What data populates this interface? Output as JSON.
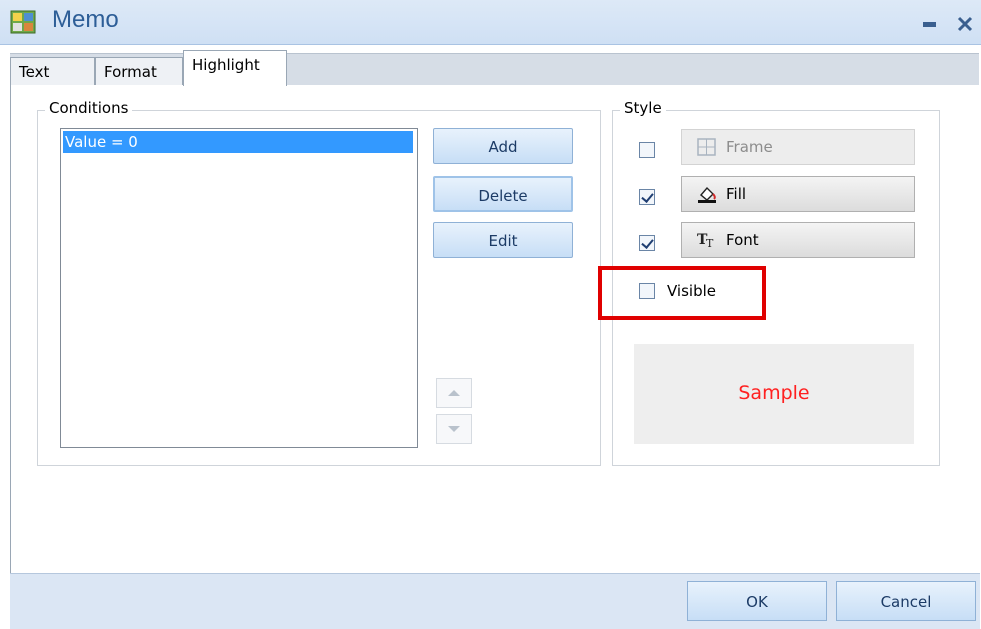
{
  "window": {
    "title": "Memo",
    "icon": "memo-app-icon",
    "controls": [
      "minimize-icon",
      "close-icon"
    ]
  },
  "tabs": [
    {
      "label": "Text",
      "active": false
    },
    {
      "label": "Format",
      "active": false
    },
    {
      "label": "Highlight",
      "active": true
    }
  ],
  "conditions": {
    "group_label": "Conditions",
    "items": [
      "Value = 0"
    ],
    "selected_index": 0,
    "buttons": {
      "add": "Add",
      "delete": "Delete",
      "edit": "Edit"
    },
    "move_up_icon": "arrow-up-icon",
    "move_down_icon": "arrow-down-icon"
  },
  "style": {
    "group_label": "Style",
    "frame": {
      "label": "Frame",
      "checked": false,
      "enabled": false,
      "icon": "frame-icon"
    },
    "fill": {
      "label": "Fill",
      "checked": true,
      "enabled": true,
      "icon": "paint-bucket-icon"
    },
    "font": {
      "label": "Font",
      "checked": true,
      "enabled": true,
      "icon": "font-icon"
    },
    "visible": {
      "label": "Visible",
      "checked": false
    },
    "sample_text": "Sample",
    "sample_color": "#ff2020",
    "highlight_color": "#e00000"
  },
  "footer": {
    "ok": "OK",
    "cancel": "Cancel"
  }
}
